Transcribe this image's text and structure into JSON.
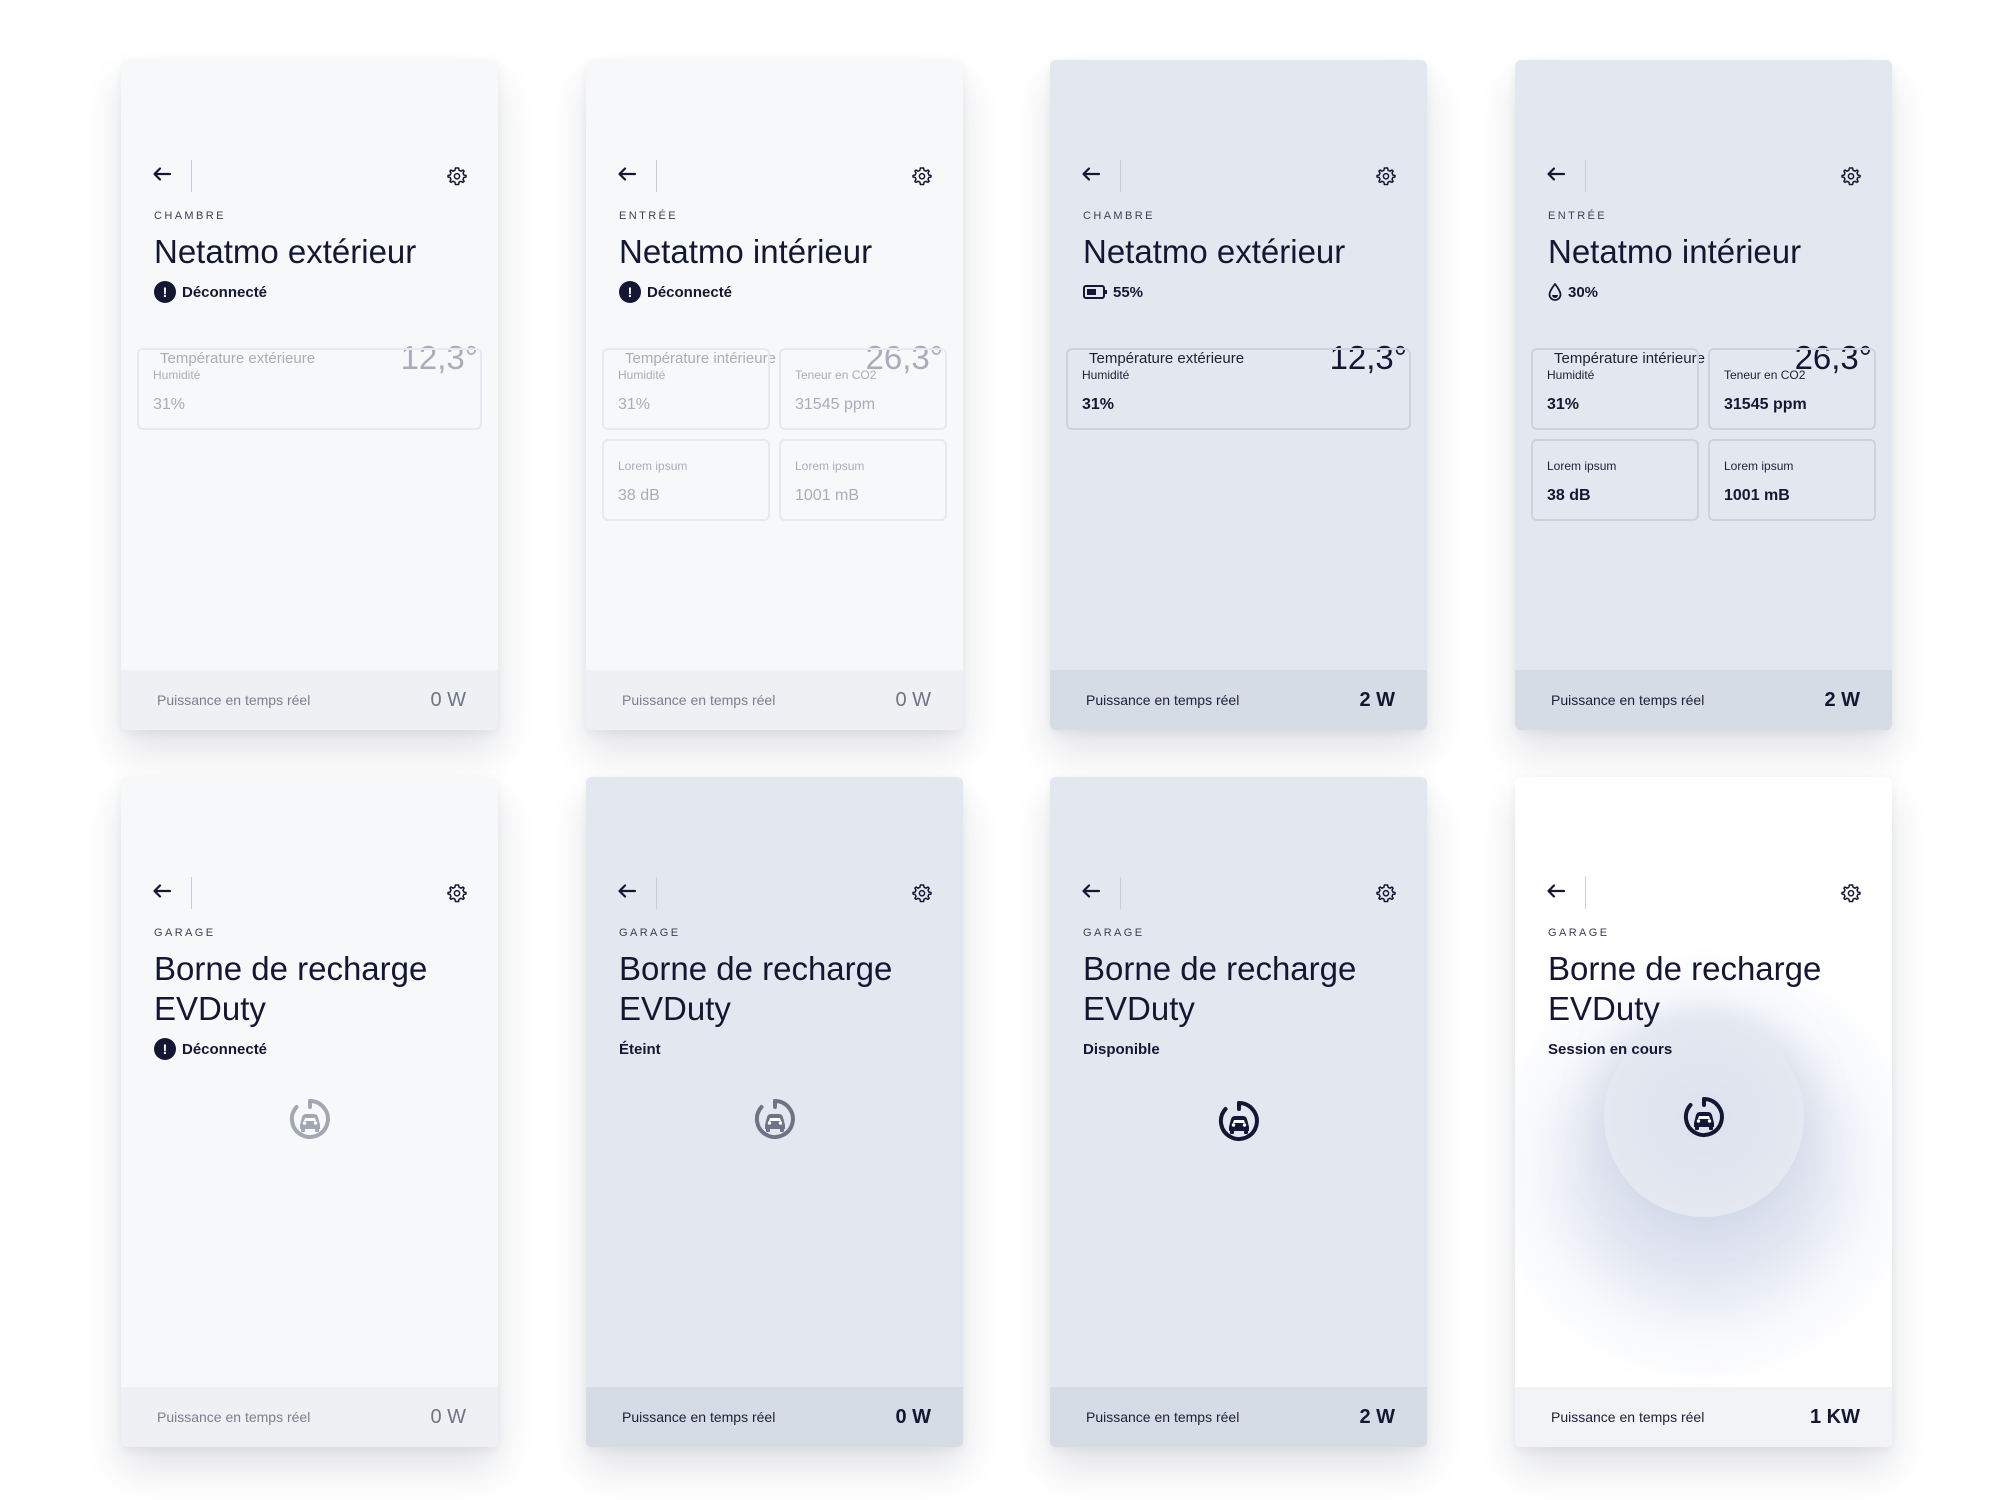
{
  "colors": {
    "ink": "#141733",
    "card_light": "#f7f8fa",
    "card_blue": "#e3e8f0",
    "card_white": "#ffffff"
  },
  "icons": {
    "back": "arrow-left-icon",
    "settings": "gear-icon",
    "alert": "exclamation-icon",
    "battery": "battery-icon",
    "humidity": "drop-icon",
    "charger": "ev-charger-icon"
  },
  "cards": [
    {
      "room": "CHAMBRE",
      "title": "Netatmo extérieur",
      "status": "Déconnecté",
      "temp_label": "Température extérieure",
      "temp_value": "12,3°",
      "tiles": [
        {
          "label": "Humidité",
          "value": "31%"
        }
      ],
      "power_label": "Puissance en temps réel",
      "power_value": "0 W"
    },
    {
      "room": "ENTRÉE",
      "title": "Netatmo intérieur",
      "status": "Déconnecté",
      "temp_label": "Température intérieure",
      "temp_value": "26,3°",
      "tiles": [
        {
          "label": "Humidité",
          "value": "31%"
        },
        {
          "label": "Teneur en CO2",
          "value": "31545 ppm"
        },
        {
          "label": "Lorem ipsum",
          "value": "38 dB"
        },
        {
          "label": "Lorem ipsum",
          "value": "1001 mB"
        }
      ],
      "power_label": "Puissance en temps réel",
      "power_value": "0 W"
    },
    {
      "room": "CHAMBRE",
      "title": "Netatmo extérieur",
      "status": "55%",
      "temp_label": "Température extérieure",
      "temp_value": "12,3°",
      "tiles": [
        {
          "label": "Humidité",
          "value": "31%"
        }
      ],
      "power_label": "Puissance en temps réel",
      "power_value": "2 W"
    },
    {
      "room": "ENTRÉE",
      "title": "Netatmo intérieur",
      "status": "30%",
      "temp_label": "Température intérieure",
      "temp_value": "26,3°",
      "tiles": [
        {
          "label": "Humidité",
          "value": "31%"
        },
        {
          "label": "Teneur en CO2",
          "value": "31545 ppm"
        },
        {
          "label": "Lorem ipsum",
          "value": "38 dB"
        },
        {
          "label": "Lorem ipsum",
          "value": "1001 mB"
        }
      ],
      "power_label": "Puissance en temps réel",
      "power_value": "2 W"
    },
    {
      "room": "GARAGE",
      "title": "Borne de recharge EVDuty",
      "status": "Déconnecté",
      "power_label": "Puissance en temps réel",
      "power_value": "0 W"
    },
    {
      "room": "GARAGE",
      "title": "Borne de recharge EVDuty",
      "status": "Éteint",
      "power_label": "Puissance en temps réel",
      "power_value": "0 W"
    },
    {
      "room": "GARAGE",
      "title": "Borne de recharge EVDuty",
      "status": "Disponible",
      "power_label": "Puissance en temps réel",
      "power_value": "2 W"
    },
    {
      "room": "GARAGE",
      "title": "Borne de recharge EVDuty",
      "status": "Session en cours",
      "power_label": "Puissance en temps réel",
      "power_value": "1 KW"
    }
  ]
}
